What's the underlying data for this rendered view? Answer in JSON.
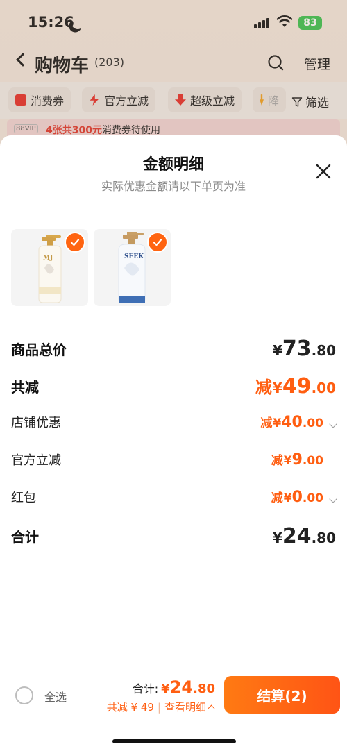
{
  "status_bar": {
    "time": "15:26",
    "battery": "83"
  },
  "nav": {
    "title": "购物车",
    "count": "(203)",
    "manage": "管理"
  },
  "filters": {
    "chips": [
      "消费券",
      "官方立减",
      "超级立减",
      "降"
    ],
    "filter_label": "筛选"
  },
  "promo": {
    "vip": "88VIP",
    "highlight": "4张共300元",
    "text": "消费券待使用"
  },
  "sheet": {
    "title": "金额明细",
    "subtitle": "实际优惠金额请以下单页为准",
    "products": [
      {
        "name": "shampoo-bottle-gold",
        "checked": true
      },
      {
        "name": "shampoo-bottle-blue",
        "checked": true
      }
    ],
    "rows": {
      "subtotal": {
        "label": "商品总价",
        "yen": "¥",
        "int": "73",
        "dec": ".80"
      },
      "total_discount": {
        "label": "共减",
        "prefix": "减",
        "yen": "¥",
        "int": "49",
        "dec": ".00"
      },
      "store_discount": {
        "label": "店铺优惠",
        "prefix": "减",
        "yen": "¥",
        "int": "40",
        "dec": ".00"
      },
      "official_discount": {
        "label": "官方立减",
        "prefix": "减",
        "yen": "¥",
        "int": "9",
        "dec": ".00"
      },
      "red_packet": {
        "label": "红包",
        "prefix": "减",
        "yen": "¥",
        "int": "0",
        "dec": ".00"
      },
      "total": {
        "label": "合计",
        "yen": "¥",
        "int": "24",
        "dec": ".80"
      }
    }
  },
  "bottom": {
    "select_all": "全选",
    "total_label": "合计:",
    "total_yen": "¥",
    "total_int": "24",
    "total_dec": ".80",
    "saving": "共减 ¥ 49",
    "details_link": "查看明细",
    "checkout": "结算(2)"
  },
  "colors": {
    "accent": "#ff5e11",
    "checkout_gradient_start": "#ff7a13",
    "checkout_gradient_end": "#ff5415"
  }
}
